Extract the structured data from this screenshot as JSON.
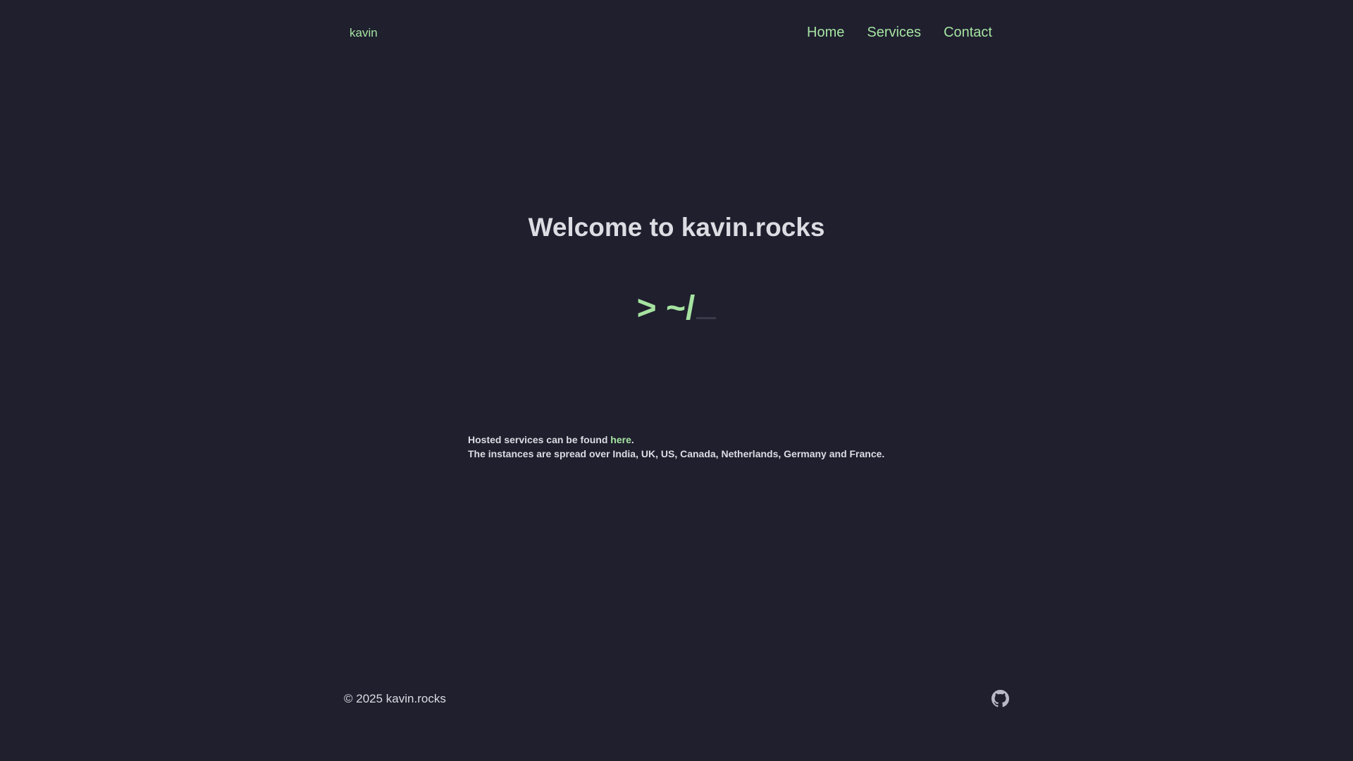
{
  "nav": {
    "logo": "kavin",
    "links": [
      "Home",
      "Services",
      "Contact"
    ]
  },
  "hero": {
    "title": "Welcome to kavin.rocks",
    "prompt": "> ~/"
  },
  "info": {
    "line1_prefix": "Hosted services can be found ",
    "line1_link": "here",
    "line1_suffix": ".",
    "line2": "The instances are spread over India, UK, US, Canada, Netherlands, Germany and France."
  },
  "footer": {
    "copyright": "© 2025 kavin.rocks",
    "icon": "github-icon"
  },
  "colors": {
    "background": "#1f1f2e",
    "accent": "#a6e3a1",
    "text": "#dcdce3"
  }
}
